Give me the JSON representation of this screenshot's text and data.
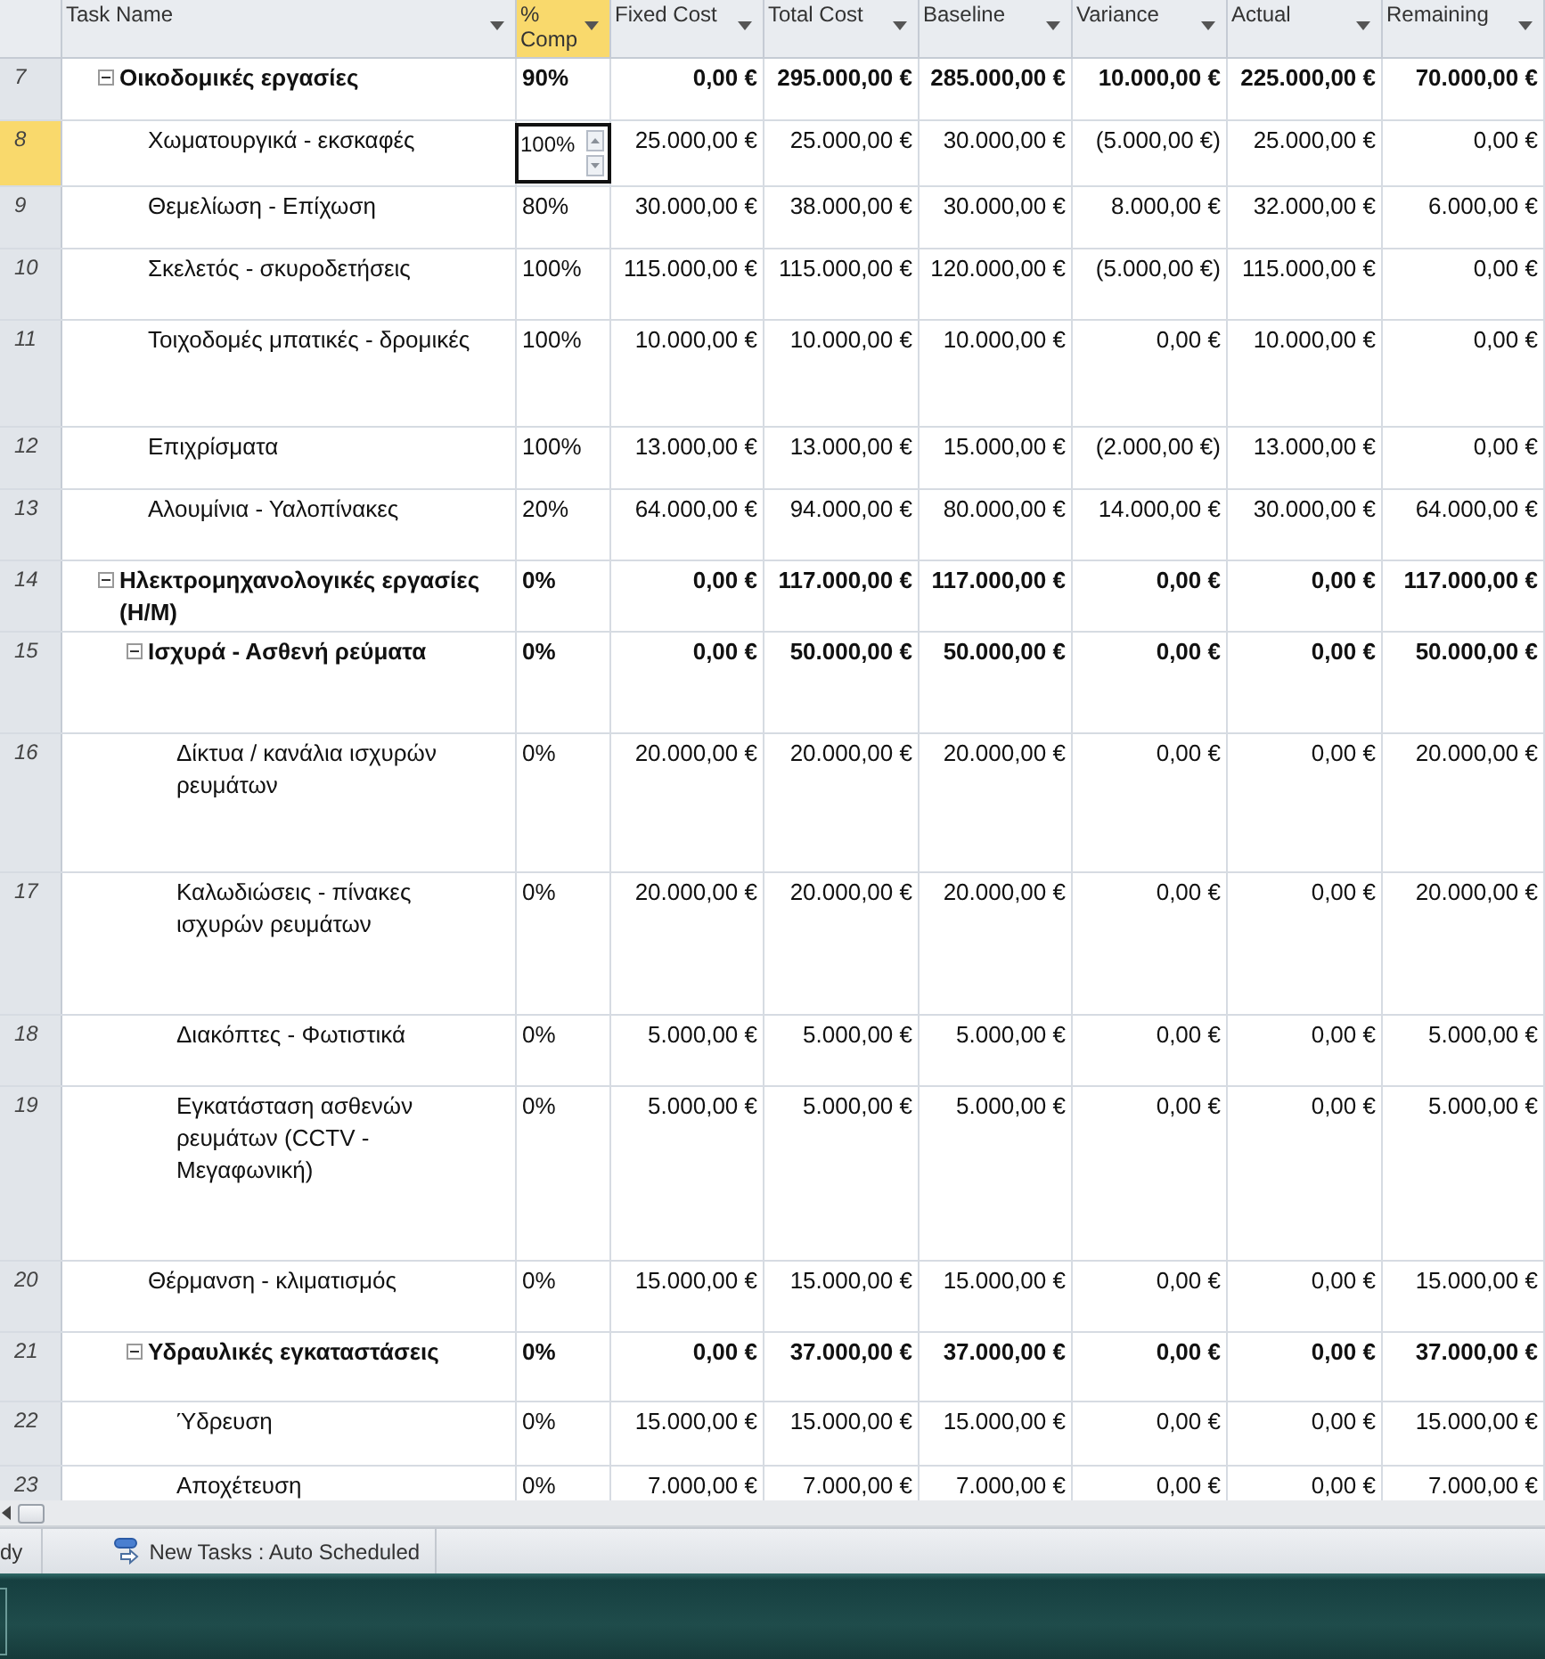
{
  "table": {
    "columns": [
      {
        "label": "Task Name",
        "selected": false
      },
      {
        "label": "% Comp",
        "selected": true
      },
      {
        "label": "Fixed Cost",
        "selected": false
      },
      {
        "label": "Total Cost",
        "selected": false
      },
      {
        "label": "Baseline",
        "selected": false
      },
      {
        "label": "Variance",
        "selected": false
      },
      {
        "label": "Actual",
        "selected": false
      },
      {
        "label": "Remaining",
        "selected": false
      }
    ],
    "rows": [
      {
        "id": "7",
        "kind": "summary",
        "expanded": true,
        "selected": false,
        "cells": [
          "Οικοδομικές εργασίες",
          "90%",
          "0,00 €",
          "295.000,00 €",
          "285.000,00 €",
          "10.000,00 €",
          "225.000,00 €",
          "70.000,00 €"
        ],
        "children": [
          {
            "id": "8",
            "kind": "task",
            "selected": true,
            "cells": [
              "Χωματουργικά - εκσκαφές",
              "100%",
              "25.000,00 €",
              "25.000,00 €",
              "30.000,00 €",
              "(5.000,00 €)",
              "25.000,00 €",
              "0,00 €"
            ]
          },
          {
            "id": "9",
            "kind": "task",
            "selected": false,
            "cells": [
              "Θεμελίωση - Επίχωση",
              "80%",
              "30.000,00 €",
              "38.000,00 €",
              "30.000,00 €",
              "8.000,00 €",
              "32.000,00 €",
              "6.000,00 €"
            ]
          },
          {
            "id": "10",
            "kind": "task",
            "selected": false,
            "cells": [
              "Σκελετός - σκυροδετήσεις",
              "100%",
              "115.000,00 €",
              "115.000,00 €",
              "120.000,00 €",
              "(5.000,00 €)",
              "115.000,00 €",
              "0,00 €"
            ]
          },
          {
            "id": "11",
            "kind": "task",
            "selected": false,
            "cells": [
              "Τοιχοδομές μπατικές - δρομικές",
              "100%",
              "10.000,00 €",
              "10.000,00 €",
              "10.000,00 €",
              "0,00 €",
              "10.000,00 €",
              "0,00 €"
            ]
          },
          {
            "id": "12",
            "kind": "task",
            "selected": false,
            "cells": [
              "Επιχρίσματα",
              "100%",
              "13.000,00 €",
              "13.000,00 €",
              "15.000,00 €",
              "(2.000,00 €)",
              "13.000,00 €",
              "0,00 €"
            ]
          },
          {
            "id": "13",
            "kind": "task",
            "selected": false,
            "cells": [
              "Αλουμίνια - Υαλοπίνακες",
              "20%",
              "64.000,00 €",
              "94.000,00 €",
              "80.000,00 €",
              "14.000,00 €",
              "30.000,00 €",
              "64.000,00 €"
            ]
          }
        ]
      },
      {
        "id": "14",
        "kind": "summary",
        "expanded": true,
        "selected": false,
        "cells": [
          "Ηλεκτρομηχανολογικές εργασίες (Η/Μ)",
          "0%",
          "0,00 €",
          "117.000,00 €",
          "117.000,00 €",
          "0,00 €",
          "0,00 €",
          "117.000,00 €"
        ],
        "children": [
          {
            "id": "15",
            "kind": "summary",
            "expanded": true,
            "selected": false,
            "cells": [
              "Ισχυρά - Ασθενή ρεύματα",
              "0%",
              "0,00 €",
              "50.000,00 €",
              "50.000,00 €",
              "0,00 €",
              "0,00 €",
              "50.000,00 €"
            ],
            "children": [
              {
                "id": "16",
                "kind": "task",
                "selected": false,
                "cells": [
                  "Δίκτυα / κανάλια ισχυρών ρευμάτων",
                  "0%",
                  "20.000,00 €",
                  "20.000,00 €",
                  "20.000,00 €",
                  "0,00 €",
                  "0,00 €",
                  "20.000,00 €"
                ]
              },
              {
                "id": "17",
                "kind": "task",
                "selected": false,
                "cells": [
                  "Καλωδιώσεις - πίνακες ισχυρών ρευμάτων",
                  "0%",
                  "20.000,00 €",
                  "20.000,00 €",
                  "20.000,00 €",
                  "0,00 €",
                  "0,00 €",
                  "20.000,00 €"
                ]
              },
              {
                "id": "18",
                "kind": "task",
                "selected": false,
                "cells": [
                  "Διακόπτες - Φωτιστικά",
                  "0%",
                  "5.000,00 €",
                  "5.000,00 €",
                  "5.000,00 €",
                  "0,00 €",
                  "0,00 €",
                  "5.000,00 €"
                ]
              },
              {
                "id": "19",
                "kind": "task",
                "selected": false,
                "cells": [
                  "Εγκατάσταση ασθενών ρευμάτων (CCTV - Μεγαφωνική)",
                  "0%",
                  "5.000,00 €",
                  "5.000,00 €",
                  "5.000,00 €",
                  "0,00 €",
                  "0,00 €",
                  "5.000,00 €"
                ]
              }
            ]
          },
          {
            "id": "20",
            "kind": "task",
            "selected": false,
            "cells": [
              "Θέρμανση - κλιματισμός",
              "0%",
              "15.000,00 €",
              "15.000,00 €",
              "15.000,00 €",
              "0,00 €",
              "0,00 €",
              "15.000,00 €"
            ]
          },
          {
            "id": "21",
            "kind": "summary",
            "expanded": true,
            "selected": false,
            "cells": [
              "Υδραυλικές εγκαταστάσεις",
              "0%",
              "0,00 €",
              "37.000,00 €",
              "37.000,00 €",
              "0,00 €",
              "0,00 €",
              "37.000,00 €"
            ],
            "children": [
              {
                "id": "22",
                "kind": "task",
                "selected": false,
                "cells": [
                  "Ύδρευση",
                  "0%",
                  "15.000,00 €",
                  "15.000,00 €",
                  "15.000,00 €",
                  "0,00 €",
                  "0,00 €",
                  "15.000,00 €"
                ]
              },
              {
                "id": "23",
                "kind": "task",
                "selected": false,
                "cells": [
                  "Αποχέτευση",
                  "0%",
                  "7.000,00 €",
                  "7.000,00 €",
                  "7.000,00 €",
                  "0,00 €",
                  "0,00 €",
                  "7.000,00 €"
                ]
              }
            ]
          }
        ]
      }
    ]
  },
  "status_bar": {
    "mode": "dy",
    "new_tasks": "New Tasks : Auto Scheduled"
  }
}
